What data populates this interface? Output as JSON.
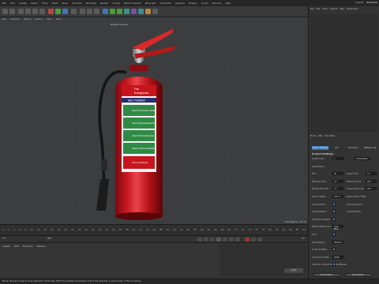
{
  "menubar": {
    "items": [
      "File",
      "Edit",
      "Create",
      "Select",
      "Tools",
      "Mesh",
      "Snap",
      "Animate",
      "Simulate",
      "Render",
      "Sculpt",
      "Motion Tracker",
      "MoGraph",
      "Character",
      "Pipeline",
      "Plugins",
      "Script",
      "Window",
      "Help"
    ],
    "layout_label": "Layout:",
    "layout_value": "Standard"
  },
  "viewport": {
    "menu": [
      "View",
      "Cameras",
      "Display",
      "Options",
      "Filter",
      "Panel"
    ],
    "camera_label": "Default Camera",
    "grid_spacing": "Grid Spacing : 10 cm"
  },
  "extinguisher": {
    "label_title_1": "Fire",
    "label_title_2": "Extinguisher",
    "label_band": "ABC POWDER",
    "label_rows": [
      "Safe for Flammable Liquids",
      "Safe for Electrical Equipment",
      "Safe for Flammable Gases",
      "Safe for Solid Combustibles",
      "Not for Cooking Oil"
    ],
    "colors": {
      "body": "#c0131b",
      "label_green": "#2f8a45",
      "label_blue": "#25306f",
      "handle": "#d82a2a"
    }
  },
  "right_panel": {
    "top_menu": [
      "File",
      "Edit",
      "View",
      "Objects",
      "Tags",
      "Bookmarks"
    ],
    "attr_menu": [
      "Mode",
      "Edit",
      "User Data"
    ],
    "attr_tabs": [
      "Project Settings",
      "Info",
      "Dynamics",
      "Referencing"
    ],
    "section_title": "Project Settings",
    "rows": [
      {
        "label": "Project Scale",
        "value": "1",
        "unit": "Centimeters"
      },
      {
        "label": "Scale Project..."
      },
      {
        "label": "FPS",
        "value": "30",
        "label2": "Project Time",
        "value2": "0 F"
      },
      {
        "label": "Minimum Time",
        "value": "0 F",
        "label2": "Maximum Time",
        "value2": "90 F"
      },
      {
        "label": "Preview Min Time",
        "value": "0 F",
        "label2": "Preview Max Time",
        "value2": "90 F"
      },
      {
        "label": "Level of Detail",
        "value": "100 %",
        "label2": "Render LOD in Editor"
      },
      {
        "label": "Use Animation",
        "label2": "Use Expressions"
      },
      {
        "label": "Use Generators",
        "label2": "Use Deformers"
      },
      {
        "label": "Use Motion System"
      },
      {
        "label": "Default Object Color",
        "value": "Gray Blue"
      },
      {
        "label": "Color"
      },
      {
        "label": "View Clipping",
        "value": "Medium"
      },
      {
        "label": "Linear Workflow"
      },
      {
        "label": "Input Color Profile",
        "value": "sRGB"
      },
      {
        "label": "Use Color Channel for Node Material"
      }
    ],
    "buttons": [
      "Load Preset...",
      "Save Preset..."
    ]
  },
  "timeline": {
    "ticks": [
      "0",
      "2",
      "4",
      "6",
      "8",
      "10",
      "12",
      "14",
      "16",
      "18",
      "20",
      "22",
      "24",
      "26",
      "28",
      "30",
      "32",
      "34",
      "36",
      "38",
      "40",
      "42",
      "44",
      "46",
      "48",
      "50",
      "52",
      "54",
      "56",
      "58",
      "60",
      "62",
      "64",
      "66",
      "68",
      "70",
      "72",
      "74",
      "76",
      "78",
      "80",
      "82",
      "84",
      "86",
      "88",
      "90"
    ],
    "current_frame": "0 F",
    "end_frame": "90 F",
    "frame_readout": "0 F"
  },
  "bottom_panel": {
    "tabs": [
      "Create",
      "Edit",
      "Function",
      "Texture"
    ],
    "apply_label": "Apply"
  },
  "status": {
    "text": "Move: Click and drag to move elements. Hold down SHIFT to quantize movement / add to the selection in point mode, CTRL to remove."
  }
}
